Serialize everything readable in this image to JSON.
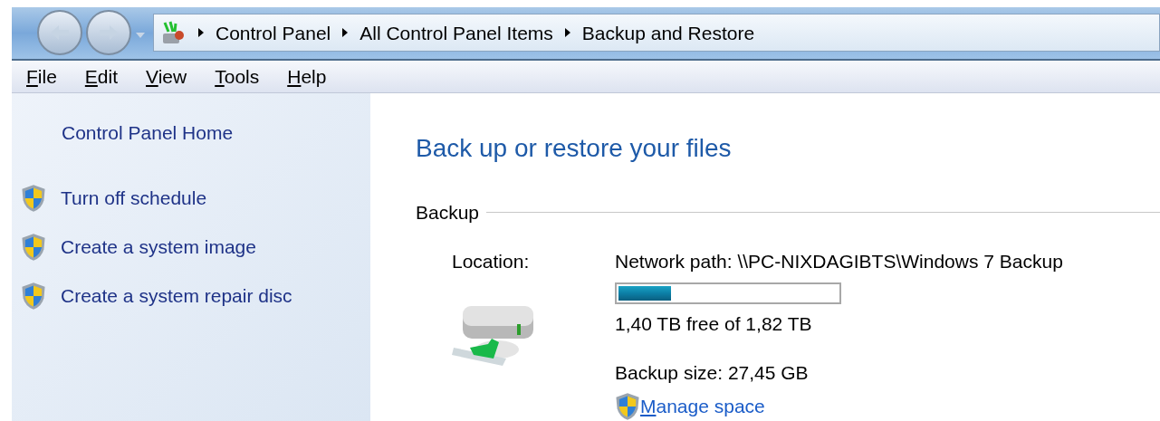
{
  "navigation": {
    "breadcrumb": [
      "Control Panel",
      "All Control Panel Items",
      "Backup and Restore"
    ]
  },
  "menu": [
    "File",
    "Edit",
    "View",
    "Tools",
    "Help"
  ],
  "sidebar": {
    "home_link": "Control Panel Home",
    "tasks": [
      "Turn off schedule",
      "Create a system image",
      "Create a system repair disc"
    ]
  },
  "content": {
    "title": "Back up or restore your files",
    "section": "Backup",
    "location_label": "Location:",
    "location_value": "Network path: \\\\PC-NIXDAGIBTS\\Windows 7 Backup",
    "usage": {
      "level": 0.24
    },
    "free_space": "1,40 TB free of 1,82 TB",
    "backup_size": "Backup size: 27,45 GB",
    "manage_link": "Manage space"
  }
}
